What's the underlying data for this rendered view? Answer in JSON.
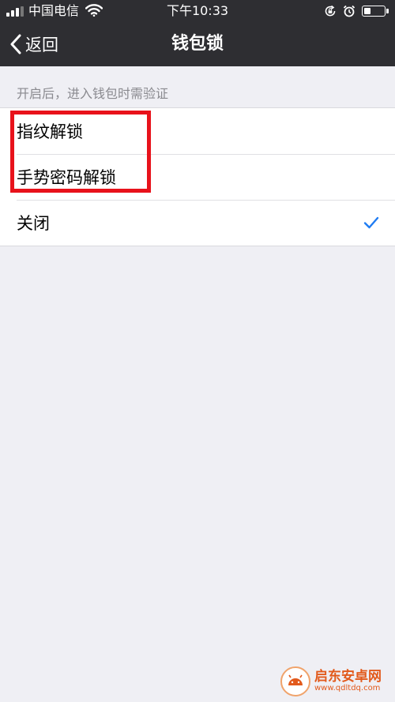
{
  "status_bar": {
    "carrier": "中国电信",
    "time": "下午10:33",
    "battery_level": 0.35
  },
  "nav": {
    "back_label": "返回",
    "title": "钱包锁"
  },
  "section_header": "开启后，进入钱包时需验证",
  "options": [
    {
      "label": "指纹解锁",
      "selected": false
    },
    {
      "label": "手势密码解锁",
      "selected": false
    },
    {
      "label": "关闭",
      "selected": true
    }
  ],
  "colors": {
    "nav_background": "#2e2e32",
    "page_background": "#efeff4",
    "check_color": "#1f7cf2",
    "highlight_color": "#e8121b"
  },
  "watermark": {
    "name": "启东安卓网",
    "url": "www.qdltdq.com"
  }
}
